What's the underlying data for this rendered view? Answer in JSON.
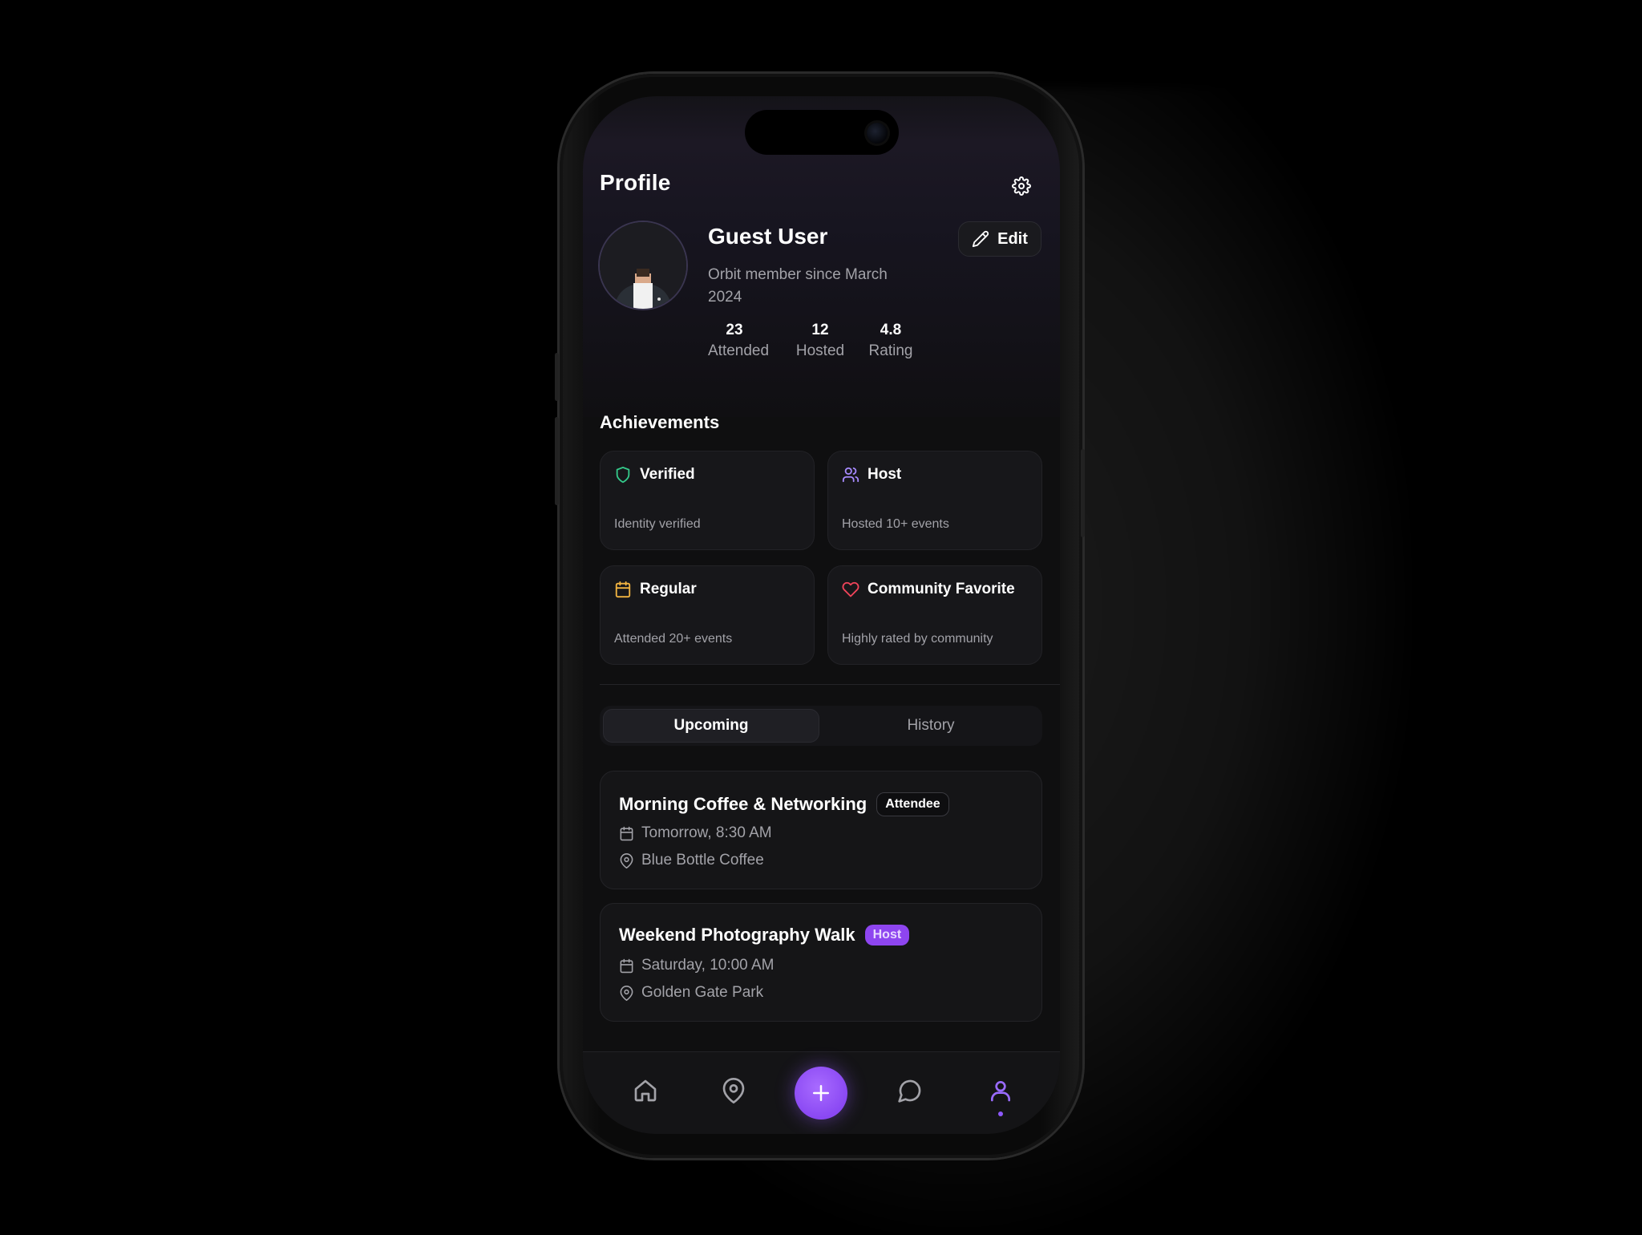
{
  "header": {
    "title": "Profile",
    "settings_icon": "gear-icon"
  },
  "profile": {
    "name": "Guest User",
    "since": "Orbit member since March 2024",
    "edit_label": "Edit",
    "stats": [
      {
        "value": "23",
        "label": "Attended"
      },
      {
        "value": "12",
        "label": "Hosted"
      },
      {
        "value": "4.8",
        "label": "Rating"
      }
    ]
  },
  "achievements": {
    "title": "Achievements",
    "items": [
      {
        "title": "Verified",
        "desc": "Identity verified",
        "icon": "shield-icon",
        "color": "#34c98a"
      },
      {
        "title": "Host",
        "desc": "Hosted 10+ events",
        "icon": "users-icon",
        "color": "#a88bff"
      },
      {
        "title": "Regular",
        "desc": "Attended 20+ events",
        "icon": "calendar-icon",
        "color": "#f2b441"
      },
      {
        "title": "Community Favorite",
        "desc": "Highly rated by community",
        "icon": "heart-icon",
        "color": "#f0445a"
      }
    ]
  },
  "tabs": {
    "upcoming": "Upcoming",
    "history": "History",
    "active": "Upcoming"
  },
  "events": [
    {
      "title": "Morning Coffee & Networking",
      "role": "Attendee",
      "time": "Tomorrow, 8:30 AM",
      "location": "Blue Bottle Coffee"
    },
    {
      "title": "Weekend Photography Walk",
      "role": "Host",
      "time": "Saturday, 10:00 AM",
      "location": "Golden Gate Park"
    }
  ],
  "bottom_nav": {
    "items": [
      "home-icon",
      "map-pin-icon",
      "plus-icon",
      "chat-icon",
      "user-icon"
    ],
    "active": "user-icon",
    "accent": "#8e48f3"
  }
}
